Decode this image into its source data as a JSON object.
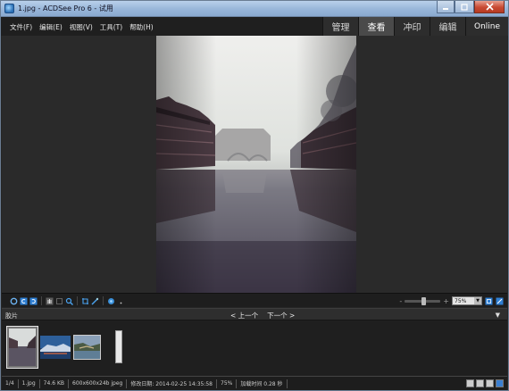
{
  "window": {
    "title": "1.jpg - ACDSee Pro 6 - 试用"
  },
  "menu": [
    "文件(F)",
    "编辑(E)",
    "视图(V)",
    "工具(T)",
    "帮助(H)"
  ],
  "modes": [
    {
      "label": "管理",
      "active": false
    },
    {
      "label": "查看",
      "active": true
    },
    {
      "label": "冲印",
      "active": false
    },
    {
      "label": "编辑",
      "active": false
    },
    {
      "label": "Online",
      "active": false
    }
  ],
  "toolbar": {
    "zoom_value": "75%",
    "zoom_minus": "-",
    "zoom_plus": "+",
    "zoom_level": 0.55
  },
  "filmstrip": {
    "title": "胶片",
    "prev_label": "< 上一个",
    "next_label": "下一个 >",
    "collapse_glyph": "▼"
  },
  "status": {
    "position": "1/4",
    "filename": "1.jpg",
    "filesize": "74.6 KB",
    "dimensions": "600x600x24b jpeg",
    "modified": "修改日期: 2014-02-25 14:35:58",
    "zoom": "75%",
    "load_time": "加载时间 0.28 秒"
  },
  "colors": {
    "active_mode": "#4a4a4a",
    "titlebar": "#98b6d9",
    "close": "#c94a33"
  }
}
